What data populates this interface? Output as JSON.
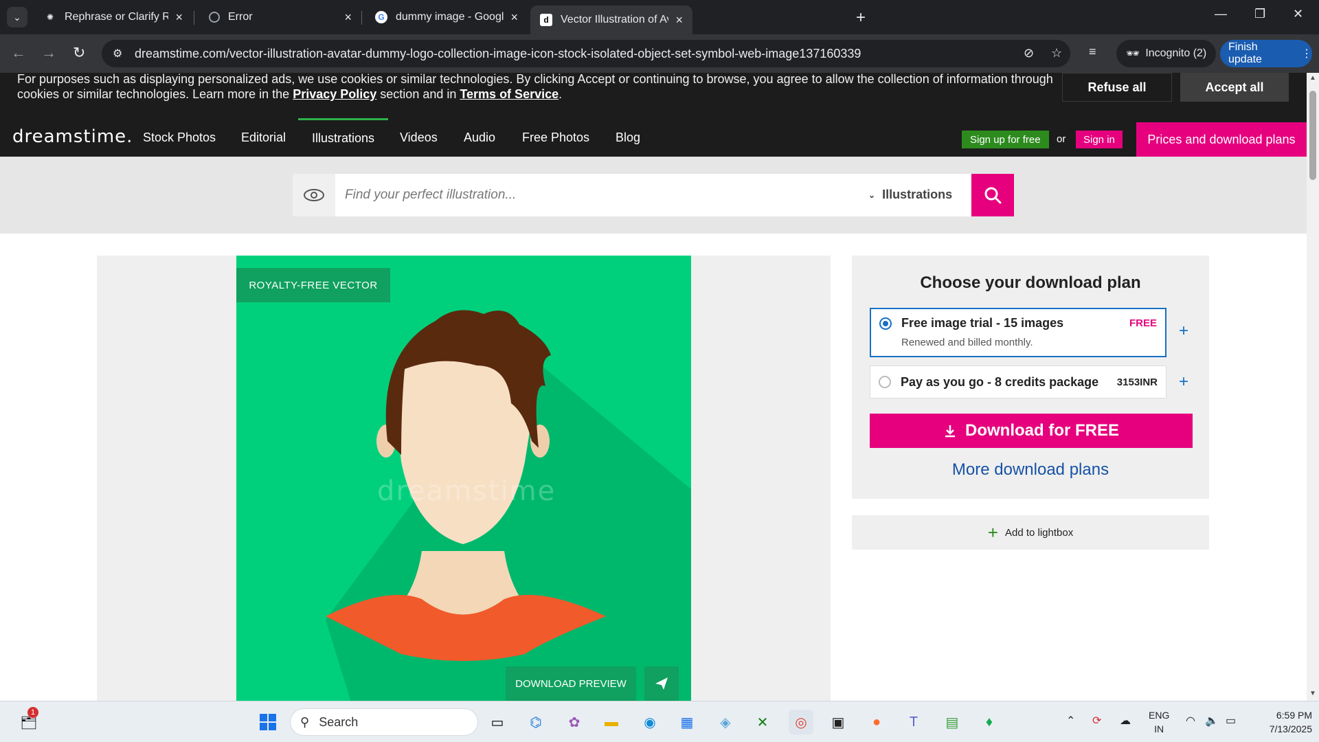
{
  "browser": {
    "tabs": [
      {
        "title": "Rephrase or Clarify Request",
        "active": false
      },
      {
        "title": "Error",
        "active": false
      },
      {
        "title": "dummy image - Google Search",
        "active": false
      },
      {
        "title": "Vector Illustration of Avatar and",
        "active": true
      }
    ],
    "url": "dreamstime.com/vector-illustration-avatar-dummy-logo-collection-image-icon-stock-isolated-object-set-symbol-web-image137160339",
    "incognito_label": "Incognito (2)",
    "finish_update_label": "Finish update"
  },
  "cookie_banner": {
    "text_line1": "For purposes such as displaying personalized ads, we use cookies or similar technologies. By clicking Accept or continuing to browse, you agree to allow the collection of information through",
    "text_line2_a": "cookies or similar technologies. Learn more in the ",
    "privacy_link": "Privacy Policy",
    "text_line2_b": " section and in ",
    "terms_link": "Terms of Service",
    "text_line2_c": ".",
    "refuse_label": "Refuse all",
    "accept_label": "Accept all"
  },
  "site_nav": {
    "logo": "dreamstime.",
    "links": [
      "Stock Photos",
      "Editorial",
      "Illustrations",
      "Videos",
      "Audio",
      "Free Photos",
      "Blog"
    ],
    "active_link": "Illustrations",
    "signup_label": "Sign up for free",
    "or_label": "or",
    "signin_label": "Sign in",
    "prices_label": "Prices and download plans"
  },
  "search": {
    "placeholder": "Find your perfect illustration...",
    "category": "Illustrations"
  },
  "image": {
    "badge": "ROYALTY-FREE VECTOR",
    "watermark": "dreamstime",
    "download_preview_label": "DOWNLOAD PREVIEW"
  },
  "plans": {
    "heading": "Choose your download plan",
    "options": [
      {
        "name": "Free image trial - 15 images",
        "sub": "Renewed and billed monthly.",
        "price": "FREE",
        "selected": true
      },
      {
        "name": "Pay as you go - 8 credits package",
        "sub": "",
        "price": "3153INR",
        "selected": false
      }
    ],
    "download_label": "Download for FREE",
    "more_plans_label": "More download plans",
    "lightbox_label": "Add to lightbox"
  },
  "taskbar": {
    "search_placeholder": "Search",
    "notification_count": "1",
    "lang_line1": "ENG",
    "lang_line2": "IN",
    "time": "6:59 PM",
    "date": "7/13/2025"
  },
  "colors": {
    "brand_pink": "#e6007e",
    "brand_green": "#2db34a",
    "art_green": "#00d07c",
    "link_blue": "#1652a6"
  }
}
